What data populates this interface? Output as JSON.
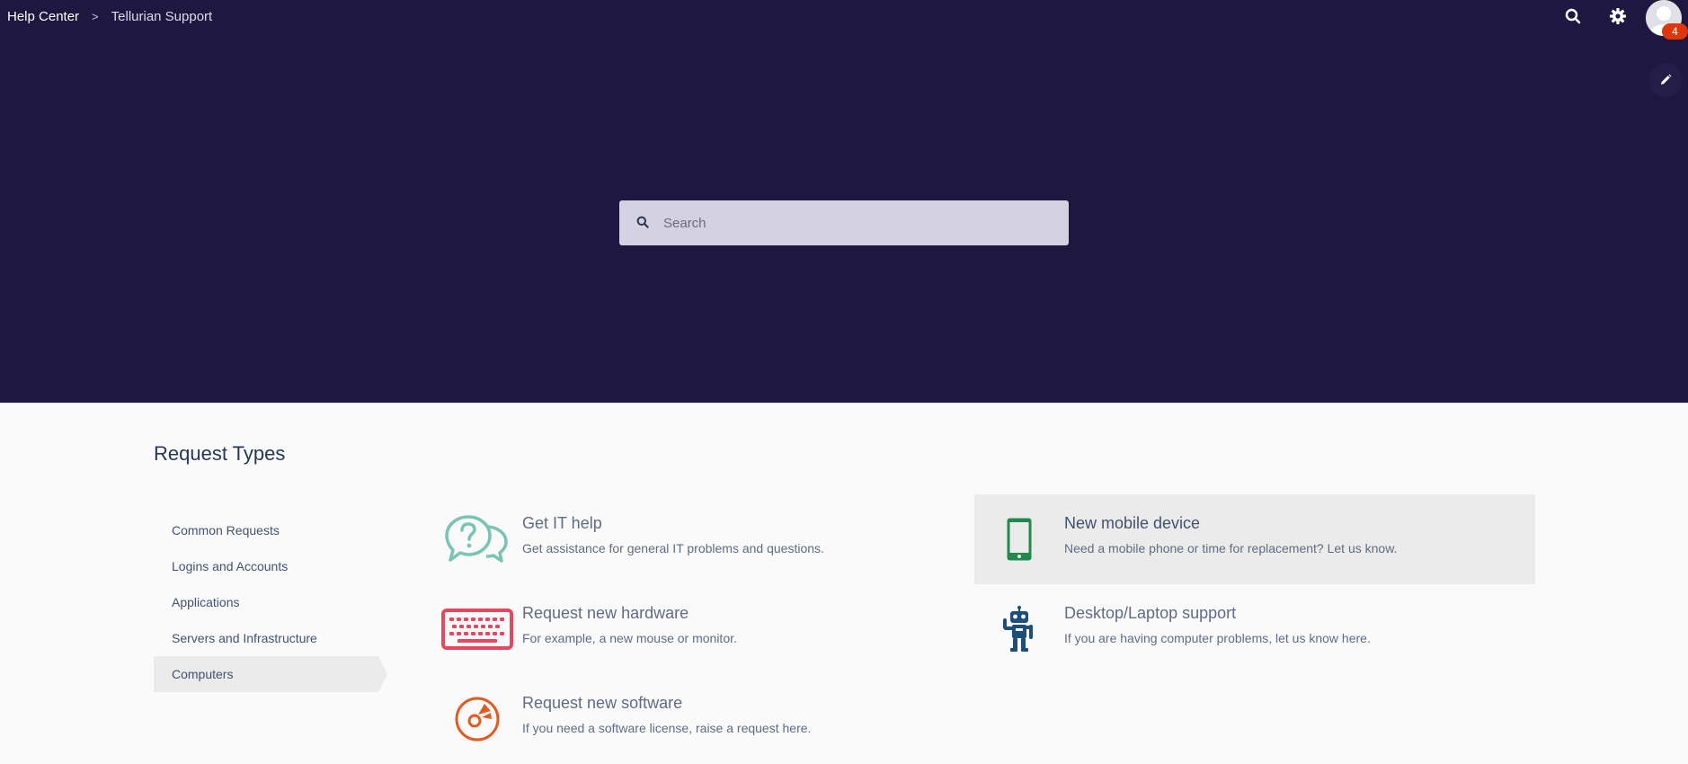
{
  "header": {
    "breadcrumb": [
      "Help Center",
      "Tellurian Support"
    ],
    "breadcrumb_separator": ">",
    "notification_count": "4",
    "icons": [
      "search-icon",
      "gear-icon",
      "avatar",
      "pencil-icon"
    ]
  },
  "search": {
    "placeholder": "Search"
  },
  "section": {
    "title": "Request Types"
  },
  "sidebar": {
    "items": [
      {
        "label": "Common Requests"
      },
      {
        "label": "Logins and Accounts"
      },
      {
        "label": "Applications"
      },
      {
        "label": "Servers and Infrastructure"
      },
      {
        "label": "Computers",
        "active": true
      }
    ]
  },
  "requests": [
    {
      "title": "Get IT help",
      "desc": "Get assistance for general IT problems and questions.",
      "icon": "chat-question-icon",
      "color": "#79c5b4"
    },
    {
      "title": "New mobile device",
      "desc": "Need a mobile phone or time for replacement? Let us know.",
      "icon": "mobile-phone-icon",
      "color": "#1f8a4c",
      "hover": true
    },
    {
      "title": "Request new hardware",
      "desc": "For example, a new mouse or monitor.",
      "icon": "keyboard-icon",
      "color": "#e5495f"
    },
    {
      "title": "Desktop/Laptop support",
      "desc": "If you are having computer problems, let us know here.",
      "icon": "robot-icon",
      "color": "#1d4e79"
    },
    {
      "title": "Request new software",
      "desc": "If you need a software license, raise a request here.",
      "icon": "software-disc-icon",
      "color": "#e05b24"
    }
  ],
  "colors": {
    "hero_bg": "#1e1840",
    "page_bg": "#fafafa",
    "badge": "#de350b"
  }
}
